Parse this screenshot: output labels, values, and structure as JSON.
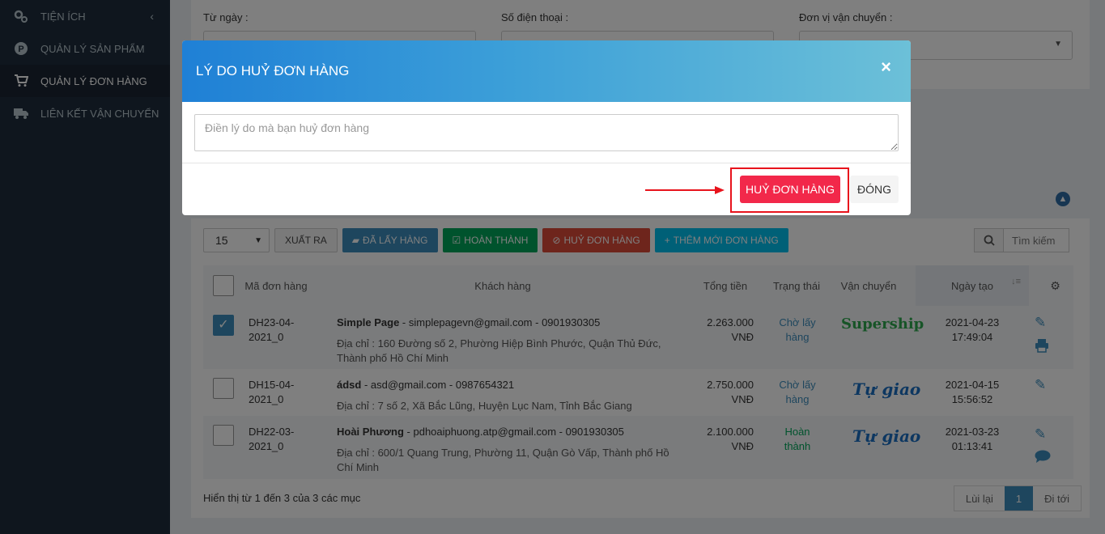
{
  "sidebar": {
    "items": [
      {
        "label": "TIỆN ÍCH",
        "icon": "gears-icon",
        "has_chevron": true
      },
      {
        "label": "QUẢN LÝ SẢN PHẨM",
        "icon": "p-circle-icon"
      },
      {
        "label": "QUẢN LÝ ĐƠN HÀNG",
        "icon": "cart-icon",
        "active": true
      },
      {
        "label": "LIÊN KẾT VẬN CHUYỂN",
        "icon": "truck-icon"
      }
    ],
    "chevron": "‹"
  },
  "filters": {
    "from_date_label": "Từ ngày :",
    "phone_label": "Số điện thoại :",
    "carrier_label": "Đơn vị vận chuyển :"
  },
  "toolbar": {
    "page_size": "15",
    "export_label": "XUẤT RA",
    "picked_label": "ĐÃ LẤY HÀNG",
    "complete_label": "HOÀN THÀNH",
    "cancel_label": "HUỶ ĐƠN HÀNG",
    "add_label": "THÊM MỚI ĐƠN HÀNG",
    "search_placeholder": "Tìm kiếm"
  },
  "table": {
    "headers": {
      "order_code": "Mã đơn hàng",
      "customer": "Khách hàng",
      "total": "Tổng tiền",
      "status": "Trạng thái",
      "shipping": "Vận chuyển",
      "created": "Ngày tạo"
    },
    "rows": [
      {
        "checked": true,
        "code": "DH23-04-2021_0",
        "name": "Simple Page",
        "contact": " - simplepagevn@gmail.com - 0901930305",
        "address": "Địa chỉ : 160 Đường số 2, Phường Hiệp Bình Phước, Quận Thủ Đức, Thành phố Hồ Chí Minh",
        "total": "2.263.000 VNĐ",
        "status": "Chờ lấy hàng",
        "shipping": "Supership",
        "date": "2021-04-23 17:49:04"
      },
      {
        "checked": false,
        "code": "DH15-04-2021_0",
        "name": "ádsd",
        "contact": " - asd@gmail.com - 0987654321",
        "address": "Địa chỉ : 7 số 2, Xã Bắc Lũng, Huyện Lục Nam, Tỉnh Bắc Giang",
        "total": "2.750.000 VNĐ",
        "status": "Chờ lấy hàng",
        "shipping": "Tự giao",
        "date": "2021-04-15 15:56:52"
      },
      {
        "checked": false,
        "code": "DH22-03-2021_0",
        "name": "Hoài Phương",
        "contact": " - pdhoaiphuong.atp@gmail.com - 0901930305",
        "address": "Địa chỉ : 600/1 Quang Trung, Phường 11, Quận Gò Vấp, Thành phố Hồ Chí Minh",
        "total": "2.100.000 VNĐ",
        "status": "Hoàn thành",
        "shipping": "Tự giao",
        "date": "2021-03-23 01:13:41"
      }
    ]
  },
  "footer": {
    "info": "Hiển thị từ 1 đến 3 của 3 các mục",
    "prev": "Lùi lại",
    "page": "1",
    "next": "Đi tới"
  },
  "modal": {
    "title": "LÝ DO HUỶ ĐƠN HÀNG",
    "close_symbol": "×",
    "reason_placeholder": "Điền lý do mà bạn huỷ đơn hàng",
    "confirm_label": "HUỶ ĐƠN HÀNG",
    "dismiss_label": "ĐÓNG"
  }
}
